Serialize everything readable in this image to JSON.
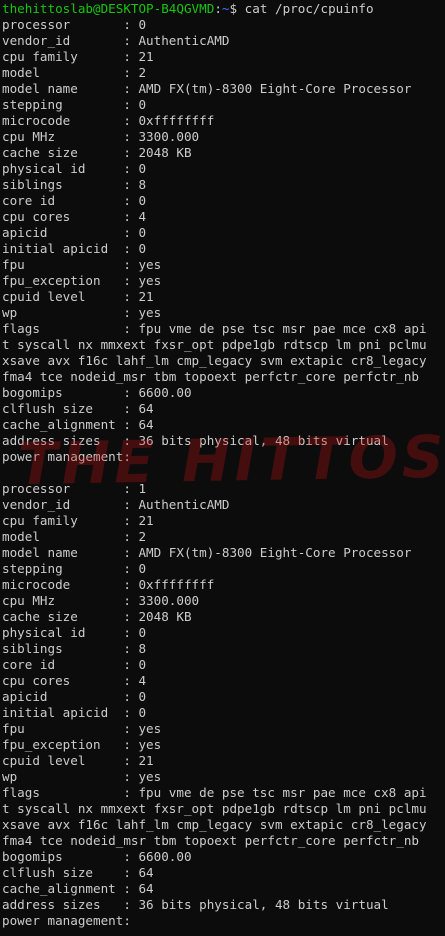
{
  "prompt": {
    "user_host": "thehittoslab@DESKTOP-B4QGVMD",
    "separator": ":",
    "path": "~",
    "symbol": "$",
    "command": " cat /proc/cpuinfo"
  },
  "lines": [
    "processor       : 0",
    "vendor_id       : AuthenticAMD",
    "cpu family      : 21",
    "model           : 2",
    "model name      : AMD FX(tm)-8300 Eight-Core Processor",
    "stepping        : 0",
    "microcode       : 0xffffffff",
    "cpu MHz         : 3300.000",
    "cache size      : 2048 KB",
    "physical id     : 0",
    "siblings        : 8",
    "core id         : 0",
    "cpu cores       : 4",
    "apicid          : 0",
    "initial apicid  : 0",
    "fpu             : yes",
    "fpu_exception   : yes",
    "cpuid level     : 21",
    "wp              : yes",
    "flags           : fpu vme de pse tsc msr pae mce cx8 api",
    "t syscall nx mmxext fxsr_opt pdpe1gb rdtscp lm pni pclmu",
    "xsave avx f16c lahf_lm cmp_legacy svm extapic cr8_legacy",
    "fma4 tce nodeid_msr tbm topoext perfctr_core perfctr_nb",
    "bogomips        : 6600.00",
    "clflush size    : 64",
    "cache_alignment : 64",
    "address sizes   : 36 bits physical, 48 bits virtual",
    "power management:",
    "",
    "processor       : 1",
    "vendor_id       : AuthenticAMD",
    "cpu family      : 21",
    "model           : 2",
    "model name      : AMD FX(tm)-8300 Eight-Core Processor",
    "stepping        : 0",
    "microcode       : 0xffffffff",
    "cpu MHz         : 3300.000",
    "cache size      : 2048 KB",
    "physical id     : 0",
    "siblings        : 8",
    "core id         : 0",
    "cpu cores       : 4",
    "apicid          : 0",
    "initial apicid  : 0",
    "fpu             : yes",
    "fpu_exception   : yes",
    "cpuid level     : 21",
    "wp              : yes",
    "flags           : fpu vme de pse tsc msr pae mce cx8 api",
    "t syscall nx mmxext fxsr_opt pdpe1gb rdtscp lm pni pclmu",
    "xsave avx f16c lahf_lm cmp_legacy svm extapic cr8_legacy",
    "fma4 tce nodeid_msr tbm topoext perfctr_core perfctr_nb",
    "bogomips        : 6600.00",
    "clflush size    : 64",
    "cache_alignment : 64",
    "address sizes   : 36 bits physical, 48 bits virtual",
    "power management:"
  ],
  "watermark": "THE HITTOS LAB",
  "colors": {
    "background": "#0c0c0c",
    "text": "#cccccc",
    "user_host": "#16c60c",
    "path": "#3b78ff",
    "watermark": "#c81414"
  }
}
